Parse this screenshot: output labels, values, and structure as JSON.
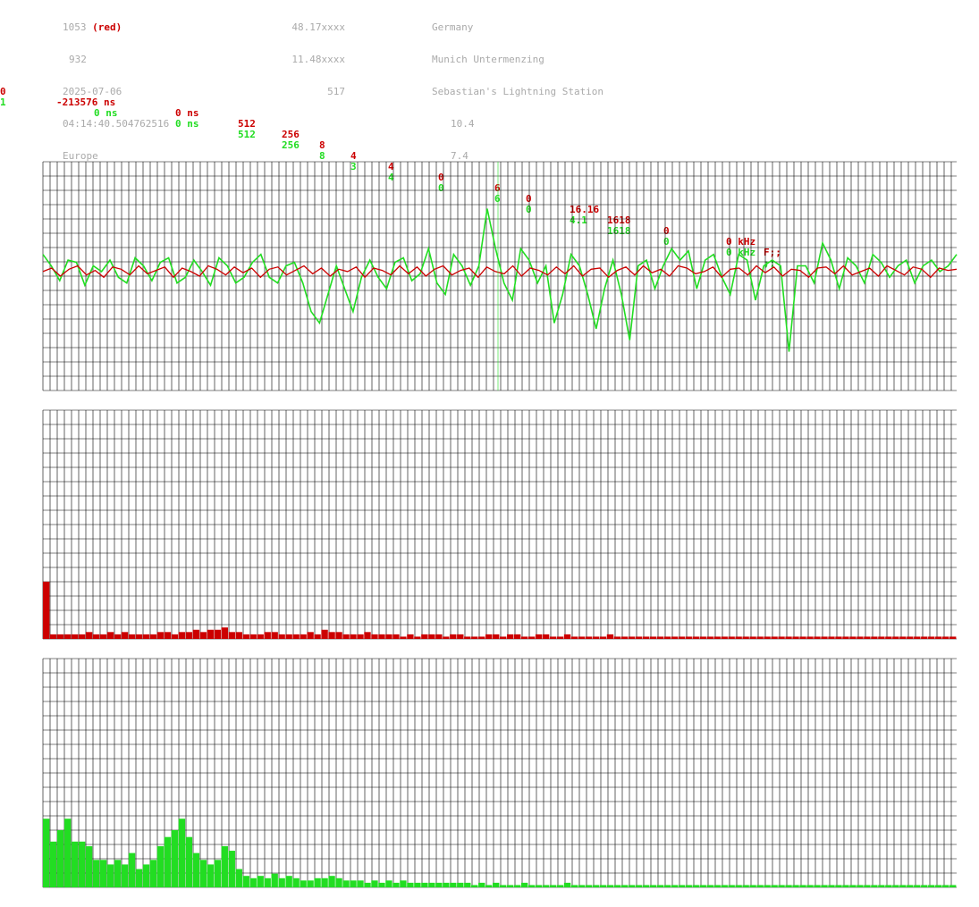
{
  "header": {
    "col1": [
      "1053",
      "932",
      "2025-07-06",
      "04:14:40.504762516",
      "Europe"
    ],
    "red_label": "(red)",
    "col2": [
      "48.17xxxx",
      "11.48xxxx",
      "517"
    ],
    "col3": [
      "Germany",
      "Munich Untermenzing",
      "Sebastian's Lightning Station",
      "10.4",
      "7.4"
    ]
  },
  "channels": [
    {
      "cells": [
        "0",
        "-213576 ns",
        "0 ns",
        "512",
        "256",
        "8",
        "4",
        "4",
        "0",
        "6",
        "0",
        "16.16",
        "1618",
        "0",
        "0 kHz",
        "F;;"
      ]
    },
    {
      "cells": [
        "1",
        "0 ns",
        "0 ns",
        "512",
        "256",
        "8",
        "3",
        "4",
        "0",
        "6",
        "0",
        "4.1",
        "1618",
        "0",
        "0 kHz",
        ";;"
      ]
    }
  ],
  "colors": {
    "red": "#cc0000",
    "green": "#22dd22",
    "grid": "#000000",
    "header": "#aaaaaa"
  },
  "chart_data": [
    {
      "type": "line",
      "title": "",
      "ylim": [
        -1,
        1
      ],
      "grid": true,
      "series": [
        {
          "color": "#22dd22",
          "values": [
            0.15,
            0.05,
            -0.08,
            0.1,
            0.08,
            -0.12,
            0.05,
            0.0,
            0.1,
            -0.05,
            -0.1,
            0.12,
            0.05,
            -0.08,
            0.08,
            0.12,
            -0.1,
            -0.05,
            0.1,
            0.0,
            -0.12,
            0.12,
            0.05,
            -0.1,
            -0.05,
            0.08,
            0.15,
            -0.05,
            -0.1,
            0.05,
            0.08,
            -0.1,
            -0.35,
            -0.45,
            -0.2,
            0.05,
            -0.15,
            -0.35,
            -0.05,
            0.1,
            -0.05,
            -0.15,
            0.08,
            0.12,
            -0.08,
            -0.02,
            0.2,
            -0.1,
            -0.2,
            0.15,
            0.05,
            -0.12,
            0.05,
            0.55,
            0.2,
            -0.1,
            -0.25,
            0.2,
            0.1,
            -0.1,
            0.05,
            -0.45,
            -0.2,
            0.15,
            0.05,
            -0.2,
            -0.5,
            -0.15,
            0.1,
            -0.2,
            -0.6,
            0.05,
            0.1,
            -0.15,
            0.05,
            0.2,
            0.1,
            0.18,
            -0.15,
            0.1,
            0.15,
            -0.05,
            -0.2,
            0.15,
            0.1,
            -0.25,
            0.05,
            0.1,
            0.05,
            -0.7,
            0.05,
            0.05,
            -0.1,
            0.25,
            0.1,
            -0.15,
            0.12,
            0.05,
            -0.1,
            0.15,
            0.08,
            -0.05,
            0.05,
            0.1,
            -0.1,
            0.05,
            0.1,
            0.0,
            0.05,
            0.15
          ]
        },
        {
          "color": "#cc0000",
          "values": [
            0.0,
            0.03,
            -0.04,
            0.02,
            0.05,
            -0.03,
            0.01,
            -0.05,
            0.04,
            0.02,
            -0.03,
            0.05,
            -0.02,
            0.01,
            0.04,
            -0.05,
            0.03,
            0.0,
            -0.04,
            0.05,
            0.02,
            -0.03,
            0.04,
            -0.01,
            0.03,
            -0.05,
            0.02,
            0.04,
            -0.03,
            0.01,
            0.05,
            -0.02,
            0.03,
            -0.04,
            0.02,
            0.0,
            0.04,
            -0.05,
            0.03,
            0.01,
            -0.03,
            0.05,
            -0.02,
            0.04,
            -0.04,
            0.02,
            0.05,
            -0.03,
            0.01,
            0.03,
            -0.05,
            0.04,
            0.0,
            -0.02,
            0.05,
            -0.04,
            0.03,
            0.01,
            -0.03,
            0.04,
            -0.02,
            0.05,
            -0.04,
            0.02,
            0.03,
            -0.05,
            0.01,
            0.04,
            -0.03,
            0.05,
            -0.01,
            0.02,
            -0.04,
            0.05,
            0.03,
            -0.02,
            0.0,
            0.04,
            -0.05,
            0.02,
            0.03,
            -0.03,
            0.05,
            -0.01,
            0.04,
            -0.04,
            0.02,
            0.01,
            -0.05,
            0.03,
            0.04,
            -0.02,
            0.05,
            -0.03,
            0.0,
            0.03,
            -0.04,
            0.05,
            0.01,
            -0.03,
            0.04,
            0.02,
            -0.05,
            0.03,
            0.01,
            0.02
          ]
        }
      ]
    },
    {
      "type": "bar",
      "title": "",
      "ylim": [
        0,
        1
      ],
      "grid": true,
      "series": [
        {
          "color": "#cc0000",
          "values": [
            0.25,
            0.02,
            0.02,
            0.02,
            0.02,
            0.02,
            0.03,
            0.02,
            0.02,
            0.03,
            0.02,
            0.03,
            0.02,
            0.02,
            0.02,
            0.02,
            0.03,
            0.03,
            0.02,
            0.03,
            0.03,
            0.04,
            0.03,
            0.04,
            0.04,
            0.05,
            0.03,
            0.03,
            0.02,
            0.02,
            0.02,
            0.03,
            0.03,
            0.02,
            0.02,
            0.02,
            0.02,
            0.03,
            0.02,
            0.04,
            0.03,
            0.03,
            0.02,
            0.02,
            0.02,
            0.03,
            0.02,
            0.02,
            0.02,
            0.02,
            0.01,
            0.02,
            0.01,
            0.02,
            0.02,
            0.02,
            0.01,
            0.02,
            0.02,
            0.01,
            0.01,
            0.01,
            0.02,
            0.02,
            0.01,
            0.02,
            0.02,
            0.01,
            0.01,
            0.02,
            0.02,
            0.01,
            0.01,
            0.02,
            0.01,
            0.01,
            0.01,
            0.01,
            0.01,
            0.02,
            0.01,
            0.01,
            0.01,
            0.01,
            0.01,
            0.01,
            0.01,
            0.01,
            0.01,
            0.01,
            0.01,
            0.01,
            0.01,
            0.01,
            0.01,
            0.01,
            0.01,
            0.01,
            0.01,
            0.01,
            0.01,
            0.01,
            0.01,
            0.01,
            0.01,
            0.01,
            0.01,
            0.01,
            0.01,
            0.01,
            0.01,
            0.01,
            0.01,
            0.01,
            0.01,
            0.01,
            0.01,
            0.01,
            0.01,
            0.01,
            0.01,
            0.01,
            0.01,
            0.01,
            0.01,
            0.01,
            0.01,
            0.01
          ]
        }
      ]
    },
    {
      "type": "bar",
      "title": "",
      "ylim": [
        0,
        1
      ],
      "grid": true,
      "series": [
        {
          "color": "#22dd22",
          "values": [
            0.3,
            0.2,
            0.25,
            0.3,
            0.2,
            0.2,
            0.18,
            0.12,
            0.12,
            0.1,
            0.12,
            0.1,
            0.15,
            0.08,
            0.1,
            0.12,
            0.18,
            0.22,
            0.25,
            0.3,
            0.22,
            0.15,
            0.12,
            0.1,
            0.12,
            0.18,
            0.16,
            0.08,
            0.05,
            0.04,
            0.05,
            0.04,
            0.06,
            0.04,
            0.05,
            0.04,
            0.03,
            0.03,
            0.04,
            0.04,
            0.05,
            0.04,
            0.03,
            0.03,
            0.03,
            0.02,
            0.03,
            0.02,
            0.03,
            0.02,
            0.03,
            0.02,
            0.02,
            0.02,
            0.02,
            0.02,
            0.02,
            0.02,
            0.02,
            0.02,
            0.01,
            0.02,
            0.01,
            0.02,
            0.01,
            0.01,
            0.01,
            0.02,
            0.01,
            0.01,
            0.01,
            0.01,
            0.01,
            0.02,
            0.01,
            0.01,
            0.01,
            0.01,
            0.01,
            0.01,
            0.01,
            0.01,
            0.01,
            0.01,
            0.01,
            0.01,
            0.01,
            0.01,
            0.01,
            0.01,
            0.01,
            0.01,
            0.01,
            0.01,
            0.01,
            0.01,
            0.01,
            0.01,
            0.01,
            0.01,
            0.01,
            0.01,
            0.01,
            0.01,
            0.01,
            0.01,
            0.01,
            0.01,
            0.01,
            0.01,
            0.01,
            0.01,
            0.01,
            0.01,
            0.01,
            0.01,
            0.01,
            0.01,
            0.01,
            0.01,
            0.01,
            0.01,
            0.01,
            0.01,
            0.01,
            0.01,
            0.01,
            0.01
          ]
        }
      ]
    }
  ]
}
